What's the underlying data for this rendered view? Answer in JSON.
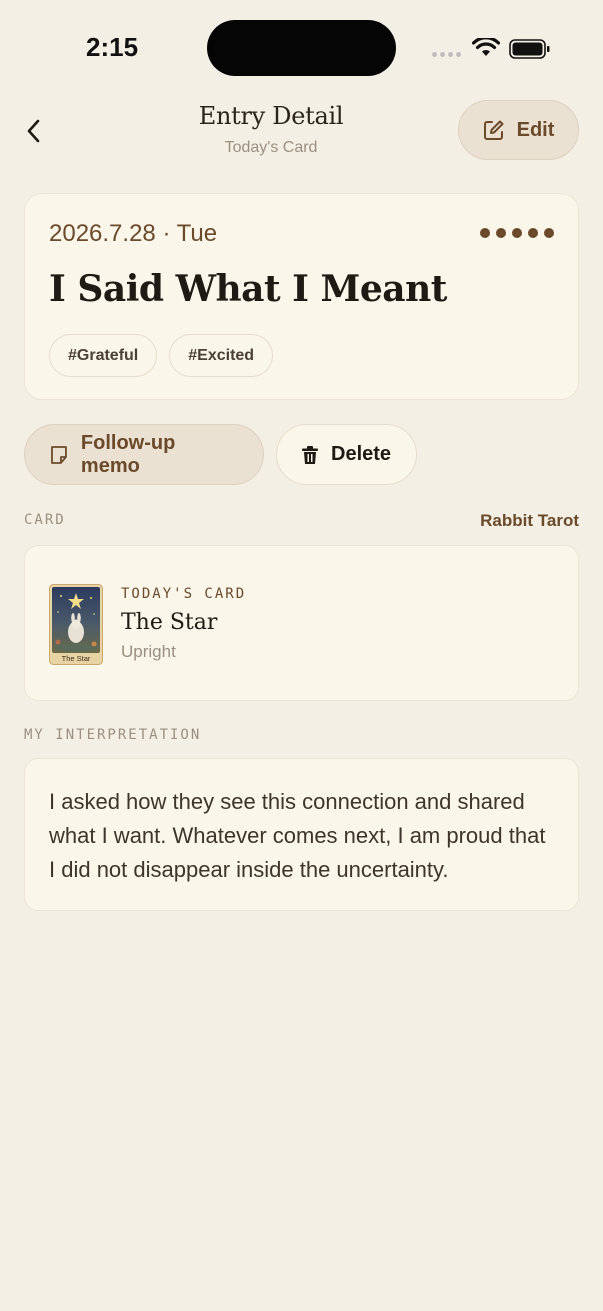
{
  "status_bar": {
    "time": "2:15"
  },
  "header": {
    "title": "Entry Detail",
    "subtitle": "Today's Card",
    "edit_label": "Edit"
  },
  "entry": {
    "date": "2026.7.28 · Tue",
    "rating": 5,
    "title": "I Said What I Meant",
    "tags": [
      "#Grateful",
      "#Excited"
    ]
  },
  "actions": {
    "memo_label": "Follow-up memo",
    "delete_label": "Delete"
  },
  "card_section": {
    "label": "CARD",
    "deck": "Rabbit Tarot",
    "kicker": "TODAY'S CARD",
    "name": "The Star",
    "orientation": "Upright",
    "thumb_caption": "The Star"
  },
  "interpretation": {
    "label": "MY INTERPRETATION",
    "text": "I asked how they see this connection and shared what I want. Whatever comes next, I am proud that I did not disappear inside the uncertainty."
  },
  "colors": {
    "background": "#f4efe4",
    "card": "#faf6ea",
    "accent_brown": "#6a4a2a",
    "muted": "#9a8f80"
  }
}
